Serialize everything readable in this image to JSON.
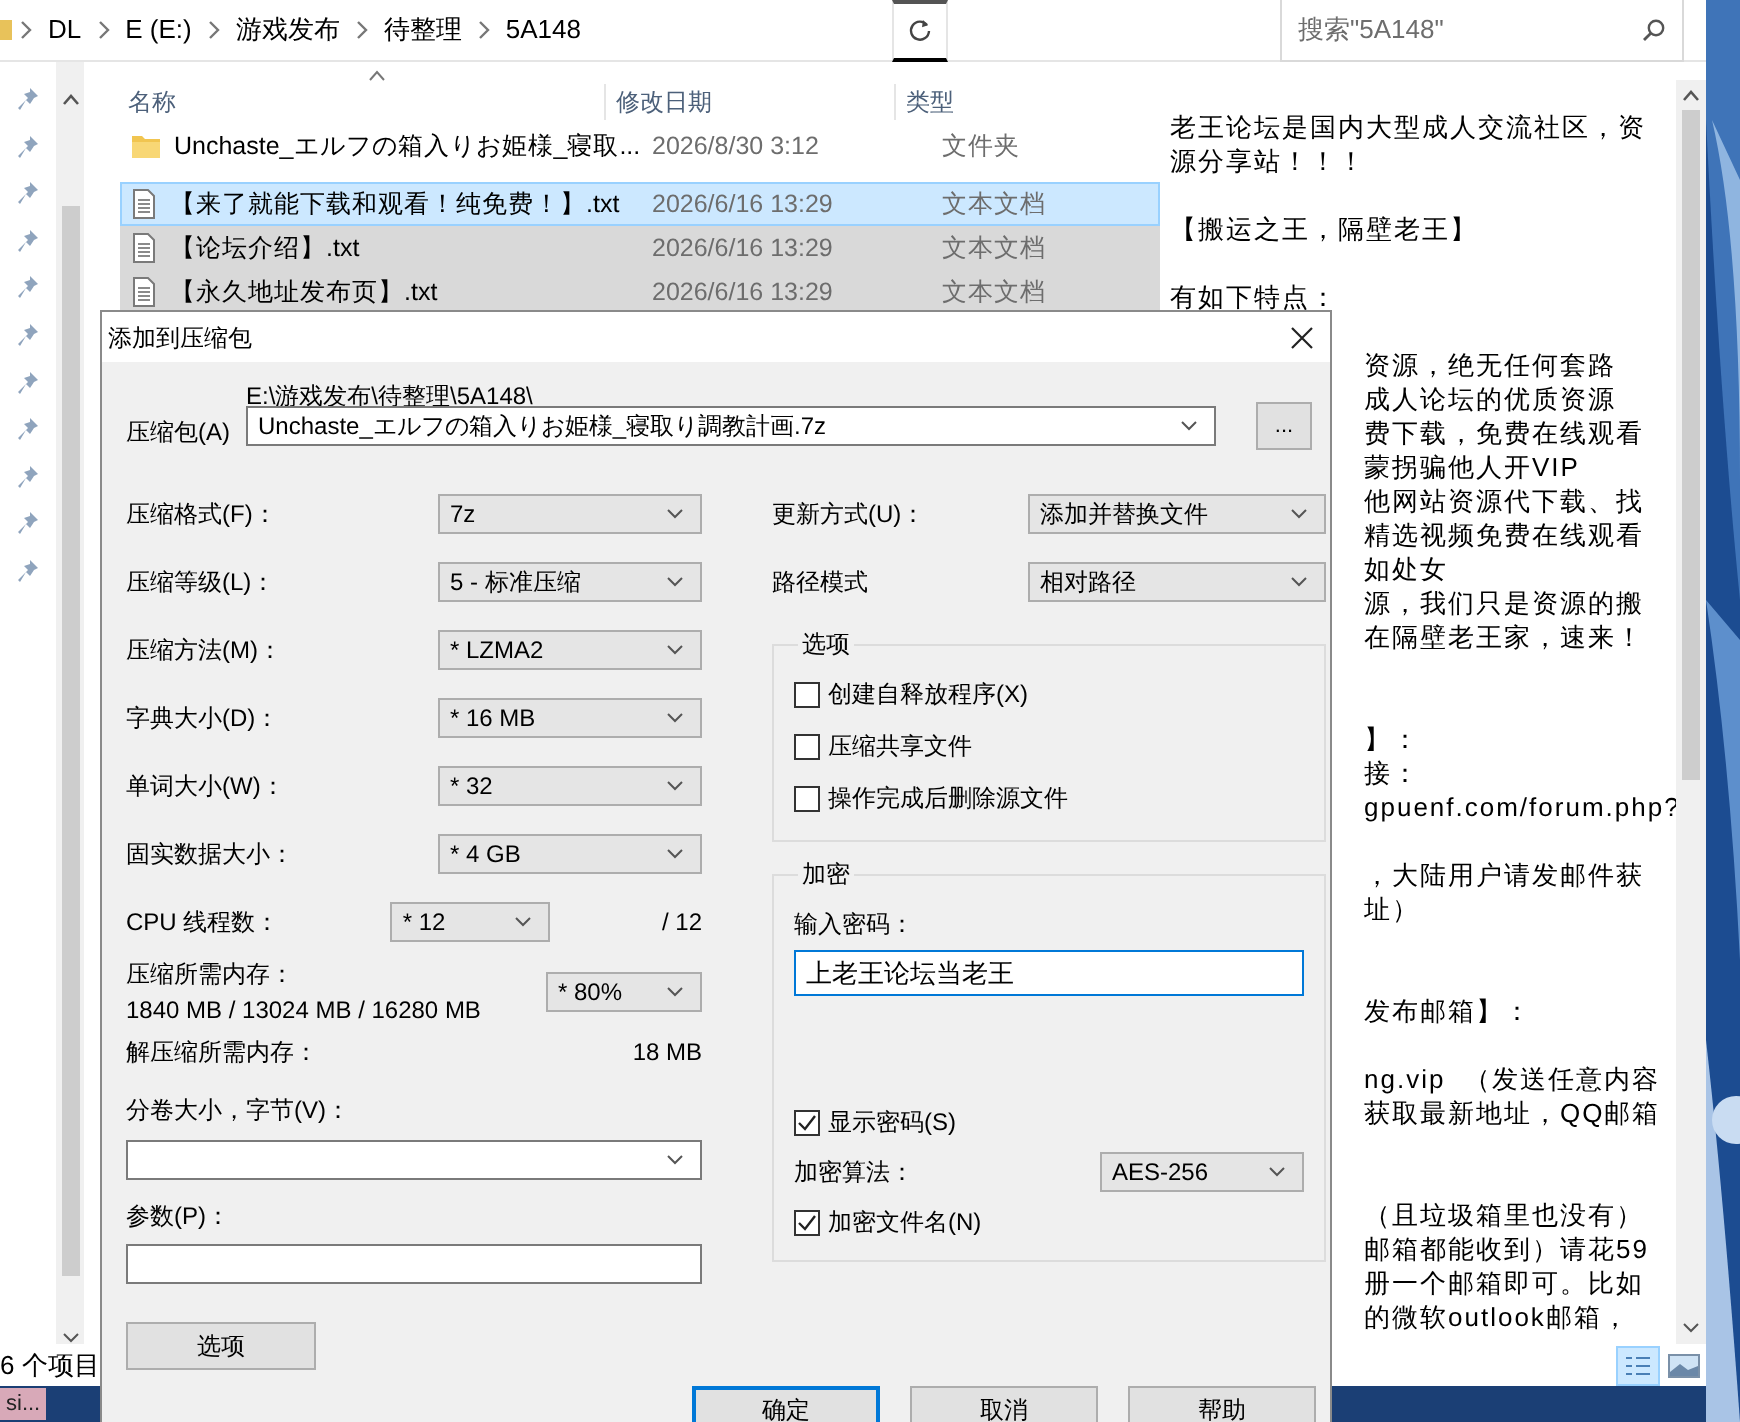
{
  "explorer": {
    "breadcrumb": [
      "DL",
      "E (E:)",
      "游戏发布",
      "待整理",
      "5A148"
    ],
    "search": {
      "placeholder": "搜索\"5A148\""
    },
    "columns": [
      "名称",
      "修改日期",
      "类型"
    ],
    "files": [
      {
        "kind": "folder",
        "name": "Unchaste_エルフの箱入りお姫様_寝取...",
        "date": "2026/8/30 3:12",
        "type": "文件夹",
        "selected": false,
        "focused": false
      },
      {
        "kind": "text",
        "name": "【来了就能下载和观看！纯免费！】.txt",
        "date": "2026/6/16 13:29",
        "type": "文本文档",
        "selected": true,
        "focused": true
      },
      {
        "kind": "text",
        "name": "【论坛介绍】.txt",
        "date": "2026/6/16 13:29",
        "type": "文本文档",
        "selected": true,
        "focused": false
      },
      {
        "kind": "text",
        "name": "【永久地址发布页】.txt",
        "date": "2026/6/16 13:29",
        "type": "文本文档",
        "selected": true,
        "focused": false
      }
    ],
    "status": "6 个项目"
  },
  "preview": {
    "lines": [
      {
        "kind": "text",
        "text": "老王论坛是国内大型成人交流社区，资"
      },
      {
        "kind": "text",
        "text": "源分享站！！！"
      },
      {
        "kind": "blank"
      },
      {
        "kind": "text",
        "text": "【搬运之王，隔壁老王】"
      },
      {
        "kind": "blank"
      },
      {
        "kind": "text",
        "text": "有如下特点："
      },
      {
        "kind": "blank"
      },
      {
        "kind": "clipped",
        "text": "资源，绝无任何套路"
      },
      {
        "kind": "clipped",
        "text": "成人论坛的优质资源"
      },
      {
        "kind": "clipped",
        "text": "费下载，免费在线观看"
      },
      {
        "kind": "clipped",
        "text": "蒙拐骗他人开VIP"
      },
      {
        "kind": "clipped",
        "text": "他网站资源代下载、找"
      },
      {
        "kind": "clipped",
        "text": "精选视频免费在线观看"
      },
      {
        "kind": "clipped",
        "text": "如处女"
      },
      {
        "kind": "clipped",
        "text": "源，我们只是资源的搬"
      },
      {
        "kind": "clipped",
        "text": "在隔壁老王家，速来！"
      },
      {
        "kind": "blank"
      },
      {
        "kind": "blank"
      },
      {
        "kind": "clipped",
        "text": "】："
      },
      {
        "kind": "clipped",
        "text": "接："
      },
      {
        "kind": "clipped",
        "text": "gpuenf.com/forum.php?"
      },
      {
        "kind": "blank"
      },
      {
        "kind": "clipped",
        "text": "，大陆用户请发邮件获"
      },
      {
        "kind": "clipped",
        "text": "址）"
      },
      {
        "kind": "blank"
      },
      {
        "kind": "blank"
      },
      {
        "kind": "clipped",
        "text": "发布邮箱】："
      },
      {
        "kind": "blank"
      },
      {
        "kind": "clipped",
        "text": "ng.vip  （发送任意内容"
      },
      {
        "kind": "clipped",
        "text": "获取最新地址，QQ邮箱"
      },
      {
        "kind": "blank"
      },
      {
        "kind": "blank"
      },
      {
        "kind": "clipped",
        "text": "（且垃圾箱里也没有）"
      },
      {
        "kind": "clipped",
        "text": "邮箱都能收到）请花59"
      },
      {
        "kind": "clipped",
        "text": "册一个邮箱即可。比如"
      },
      {
        "kind": "clipped",
        "text": "的微软outlook邮箱，"
      }
    ]
  },
  "taskbar": {
    "items": [
      "si..."
    ]
  },
  "dialog": {
    "title": "添加到压缩包",
    "archive": {
      "label": "压缩包(A)",
      "path": "E:\\游戏发布\\待整理\\5A148\\",
      "value": "Unchaste_エルフの箱入りお姫様_寝取り調教計画.7z",
      "browse": "..."
    },
    "settings": [
      {
        "label": "压缩格式(F)：",
        "value": "7z"
      },
      {
        "label": "压缩等级(L)：",
        "value": "5 - 标准压缩"
      },
      {
        "label": "压缩方法(M)：",
        "value": "* LZMA2"
      },
      {
        "label": "字典大小(D)：",
        "value": "* 16 MB"
      },
      {
        "label": "单词大小(W)：",
        "value": "* 32"
      },
      {
        "label": "固实数据大小：",
        "value": "* 4 GB"
      }
    ],
    "cpu": {
      "label": "CPU 线程数：",
      "value": "* 12",
      "max": "/ 12"
    },
    "memory": {
      "label": "压缩所需内存：",
      "detail": "1840 MB / 13024 MB / 16280 MB",
      "value": "* 80%"
    },
    "decompress": {
      "label": "解压缩所需内存：",
      "value": "18 MB"
    },
    "volume": {
      "label": "分卷大小，字节(V)："
    },
    "params": {
      "label": "参数(P)："
    },
    "options_button": "选项",
    "update": [
      {
        "label": "更新方式(U)：",
        "value": "添加并替换文件"
      },
      {
        "label": "路径模式",
        "value": "相对路径"
      }
    ],
    "options": {
      "title": "选项",
      "items": [
        {
          "label": "创建自释放程序(X)",
          "checked": false
        },
        {
          "label": "压缩共享文件",
          "checked": false
        },
        {
          "label": "操作完成后删除源文件",
          "checked": false
        }
      ]
    },
    "encryption": {
      "title": "加密",
      "password_label": "输入密码：",
      "password": "上老王论坛当老王",
      "show_password": {
        "label": "显示密码(S)",
        "checked": true
      },
      "method_label": "加密算法：",
      "method": "AES-256",
      "encrypt_names": {
        "label": "加密文件名(N)",
        "checked": true
      }
    },
    "buttons": [
      {
        "label": "确定",
        "default": true
      },
      {
        "label": "取消",
        "default": false
      },
      {
        "label": "帮助",
        "default": false
      }
    ]
  }
}
